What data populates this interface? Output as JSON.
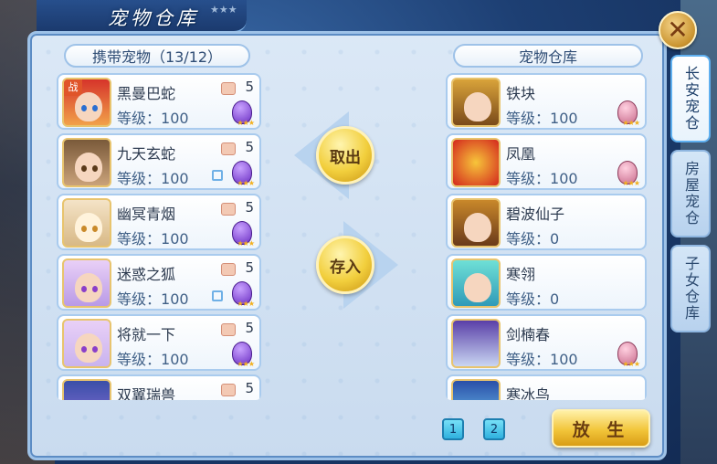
{
  "window": {
    "title": "宠物仓库"
  },
  "header": {
    "stars": "★★★"
  },
  "carried": {
    "header": "携带宠物（13/12）",
    "level_label": "等级：",
    "items": [
      {
        "name": "黑曼巴蛇",
        "level": "100",
        "count": "5",
        "badge": "战",
        "locked": false,
        "egg": "purple",
        "stars": "★★★"
      },
      {
        "name": "九天玄蛇",
        "level": "100",
        "count": "5",
        "badge": "",
        "locked": true,
        "egg": "purple",
        "stars": "★★★"
      },
      {
        "name": "幽冥青烟",
        "level": "100",
        "count": "5",
        "badge": "",
        "locked": false,
        "egg": "purple",
        "stars": "★★★"
      },
      {
        "name": "迷惑之狐",
        "level": "100",
        "count": "5",
        "badge": "",
        "locked": true,
        "egg": "purple",
        "stars": "★★★"
      },
      {
        "name": "将就一下",
        "level": "100",
        "count": "5",
        "badge": "",
        "locked": false,
        "egg": "purple",
        "stars": "★★★"
      },
      {
        "name": "双翼瑞兽",
        "level": "",
        "count": "5",
        "badge": "",
        "locked": false,
        "egg": "",
        "stars": ""
      }
    ]
  },
  "storage": {
    "header": "宠物仓库",
    "level_label": "等级：",
    "items": [
      {
        "name": "铁块",
        "level": "100",
        "egg": "pink",
        "stars": "★★★"
      },
      {
        "name": "凤凰",
        "level": "100",
        "egg": "pink",
        "stars": "★★★"
      },
      {
        "name": "碧波仙子",
        "level": "0",
        "egg": "",
        "stars": ""
      },
      {
        "name": "寒翎",
        "level": "0",
        "egg": "",
        "stars": ""
      },
      {
        "name": "剑楠春",
        "level": "100",
        "egg": "pink",
        "stars": "★★★"
      },
      {
        "name": "寒冰鸟",
        "level": "",
        "egg": "",
        "stars": ""
      }
    ]
  },
  "actions": {
    "take_out": "取出",
    "deposit": "存入",
    "release": "放 生"
  },
  "tabs": [
    {
      "label": "长安宠仓",
      "active": true
    },
    {
      "label": "房屋宠仓",
      "active": false
    },
    {
      "label": "子女仓库",
      "active": false
    }
  ],
  "pagination": {
    "pages": [
      "1",
      "2"
    ]
  },
  "colors": {
    "accent": "#9ec2e8",
    "button_gold": "#f2c53a",
    "text_dark": "#2c3a4f"
  }
}
